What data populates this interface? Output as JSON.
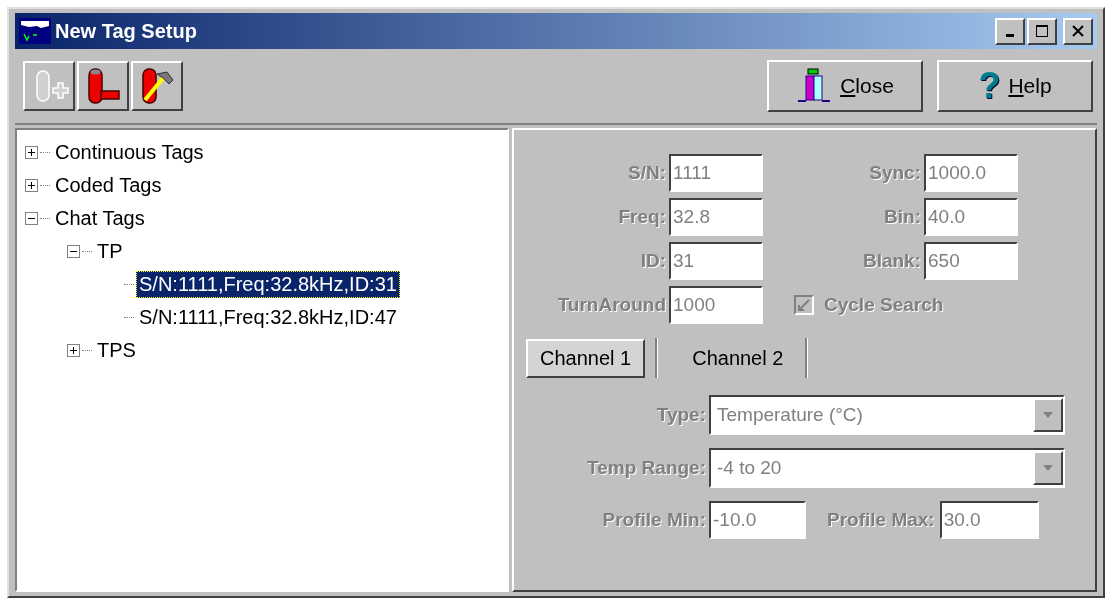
{
  "window": {
    "title": "New Tag Setup"
  },
  "toolbar": {
    "tools": [
      {
        "kind": "add-tag",
        "disabled": true
      },
      {
        "kind": "pipe-tag",
        "disabled": false
      },
      {
        "kind": "hammer-tag",
        "disabled": false
      }
    ],
    "buttons": [
      {
        "kind": "close",
        "label": "Close"
      },
      {
        "kind": "help",
        "label": "Help",
        "icon": "?"
      }
    ]
  },
  "tree": [
    {
      "label": "Continuous Tags",
      "expanded": false,
      "selected": false
    },
    {
      "label": "Coded Tags",
      "expanded": false,
      "selected": false
    },
    {
      "label": "Chat Tags",
      "expanded": true,
      "selected": false,
      "children": [
        {
          "label": "TP",
          "expanded": true,
          "selected": false,
          "children": [
            {
              "label": "S/N:1111,Freq:32.8kHz,ID:31",
              "selected": true
            },
            {
              "label": "S/N:1111,Freq:32.8kHz,ID:47",
              "selected": false
            }
          ]
        },
        {
          "label": "TPS",
          "expanded": false,
          "selected": false
        }
      ]
    }
  ],
  "form": {
    "disabled": true,
    "fields": [
      {
        "label": "S/N:",
        "value": "1111"
      },
      {
        "label": "Sync:",
        "value": "1000.0"
      },
      {
        "label": "Freq:",
        "value": "32.8"
      },
      {
        "label": "Bin:",
        "value": "40.0"
      },
      {
        "label": "ID:",
        "value": "31"
      },
      {
        "label": "Blank:",
        "value": "650"
      },
      {
        "label": "TurnAround",
        "value": "1000"
      }
    ],
    "checkbox": {
      "label": "Cycle Search",
      "checked": true
    },
    "tabs": [
      {
        "label": "Channel 1",
        "selected": true
      },
      {
        "label": "Channel 2",
        "selected": false
      }
    ],
    "dropdowns": [
      {
        "label": "Type:",
        "value": "Temperature (°C)"
      },
      {
        "label": "Temp Range:",
        "value": "-4 to 20"
      }
    ],
    "profile": [
      {
        "label": "Profile Min:",
        "value": "-10.0"
      },
      {
        "label": "Profile Max:",
        "value": "30.0"
      }
    ]
  }
}
